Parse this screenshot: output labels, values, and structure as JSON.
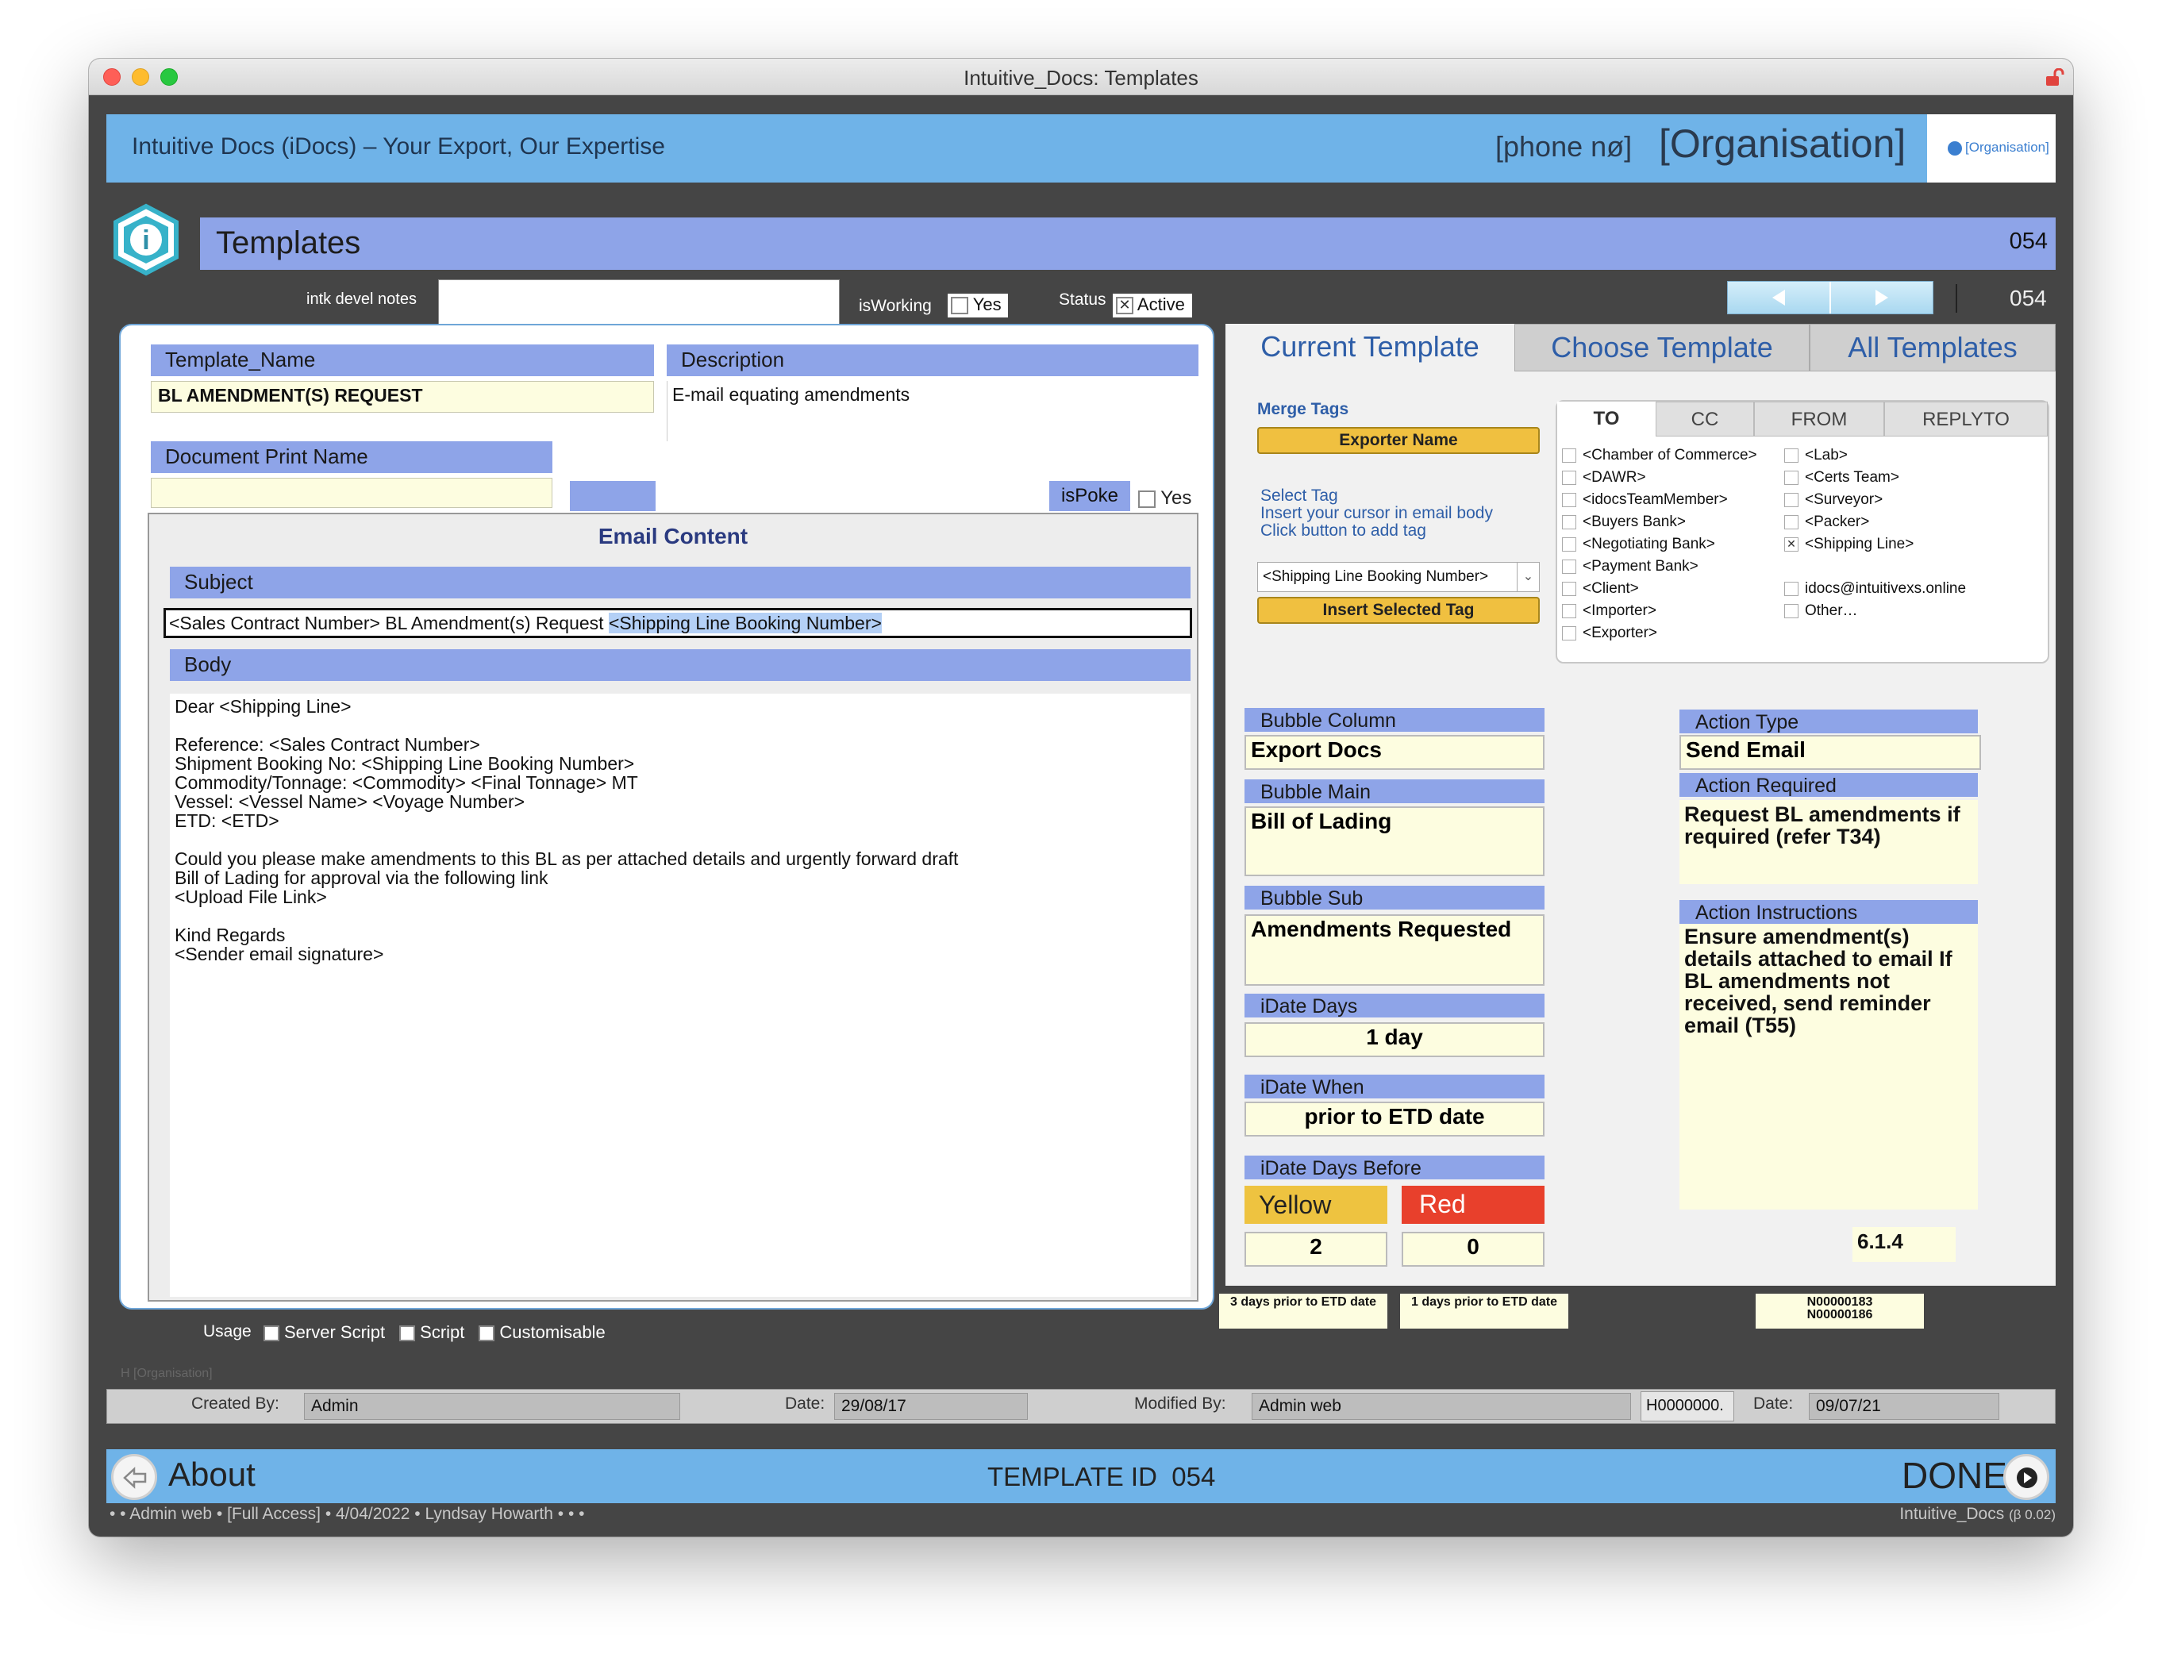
{
  "window": {
    "title": "Intuitive_Docs: Templates"
  },
  "banner": {
    "tagline": "Intuitive Docs (iDocs) – Your Export, Our Expertise",
    "phone": "[phone nø]",
    "organisation": "[Organisation]",
    "logo_text": "[Organisation]"
  },
  "page": {
    "title": "Templates",
    "record_id": "054",
    "nav_id": "054"
  },
  "top_controls": {
    "notes_label": "intk devel notes",
    "notes_value": "",
    "isworking_label": "isWorking",
    "isworking_option": "Yes",
    "status_label": "Status",
    "status_option": "Active"
  },
  "left": {
    "template_name_label": "Template_Name",
    "template_name_value": "BL AMENDMENT(S) REQUEST",
    "description_label": "Description",
    "description_value": "E-mail equating amendments",
    "print_name_label": "Document Print Name",
    "print_name_value": "",
    "ispoke_label": "isPoke",
    "ispoke_option": "Yes",
    "email_content_title": "Email Content",
    "subject_label": "Subject",
    "subject_plain": "<Sales Contract Number> BL Amendment(s) Request ",
    "subject_selected": "<Shipping Line Booking Number>",
    "body_label": "Body",
    "body_lines": [
      "Dear <Shipping Line>",
      "",
      "Reference: <Sales Contract Number>",
      "Shipment Booking No: <Shipping Line Booking Number>",
      "Commodity/Tonnage: <Commodity> <Final Tonnage> MT",
      "Vessel: <Vessel Name> <Voyage Number>",
      "ETD: <ETD>",
      "",
      "Could you please make amendments to this BL as per attached details and urgently forward draft",
      "Bill of Lading for approval via the following link",
      "<Upload File Link>",
      "",
      "Kind Regards",
      "<Sender email signature>"
    ]
  },
  "usage": {
    "label": "Usage",
    "options": [
      "Server Script",
      "Script",
      "Customisable"
    ]
  },
  "tabs": [
    "Current Template",
    "Choose Template",
    "All Templates"
  ],
  "merge": {
    "title": "Merge Tags",
    "exporter_button": "Exporter Name",
    "select_tag_lines": [
      "Select Tag",
      "Insert your cursor in email body",
      "Click button to add tag"
    ],
    "dropdown_value": "<Shipping Line Booking Number>",
    "insert_button": "Insert Selected Tag"
  },
  "recipient_tabs": [
    "TO",
    "CC",
    "FROM",
    "REPLYTO"
  ],
  "recipients_col1": [
    "<Chamber of Commerce>",
    "<DAWR>",
    "<idocsTeamMember>",
    "<Buyers Bank>",
    "<Negotiating Bank>",
    "<Payment Bank>",
    "<Client>",
    "<Importer>",
    "<Exporter>"
  ],
  "recipients_col2": [
    "<Lab>",
    "<Certs Team>",
    "<Surveyor>",
    "<Packer>",
    "<Shipping Line>",
    "",
    "idocs@intuitivexs.online",
    "Other…"
  ],
  "recipients_col2_checked": [
    false,
    false,
    false,
    false,
    true,
    false,
    false,
    false
  ],
  "bubble": {
    "column_label": "Bubble Column",
    "column_value": "Export Docs",
    "main_label": "Bubble Main",
    "main_value": "Bill of Lading",
    "sub_label": "Bubble Sub",
    "sub_value": "Amendments Requested",
    "idate_days_label": "iDate Days",
    "idate_days_value": "1 day",
    "idate_when_label": "iDate When",
    "idate_when_value": "prior to ETD date",
    "idate_before_label": "iDate Days Before",
    "yellow_label": "Yellow",
    "red_label": "Red",
    "yellow_value": "2",
    "red_value": "0",
    "yellow_note": "3 days prior to ETD date",
    "red_note": "1 days prior to ETD date"
  },
  "action": {
    "type_label": "Action Type",
    "type_value": "Send Email",
    "required_label": "Action Required",
    "required_value": "Request BL amendments if required (refer T34)",
    "instructions_label": "Action Instructions",
    "instructions_value": "Ensure amendment(s) details attached to email If BL amendments not received, send reminder email (T55)",
    "version": "6.1.4",
    "ids": [
      "N00000183",
      "N00000186"
    ]
  },
  "footer_strip": {
    "org_hint": "H   [Organisation]",
    "created_label": "Created By:",
    "created_value": "Admin",
    "date_label": "Date:",
    "date_value": "29/08/17",
    "modified_label": "Modified By:",
    "modified_value": "Admin web",
    "h_code": "H0000000.",
    "date2_label": "Date:",
    "date2_value": "09/07/21"
  },
  "bottom_bar": {
    "about_label": "About",
    "template_id_label": "TEMPLATE ID",
    "template_id_value": "054",
    "done_label": "DONE"
  },
  "status_line": {
    "left": "•  • Admin web • [Full Access] • 4/04/2022 • Lyndsay Howarth •  •  •",
    "right_app": "Intuitive_Docs",
    "right_version": "(β 0.02)"
  },
  "colors": {
    "window_bg": "#454545",
    "banner_blue": "#6fb3e8",
    "header_blue": "#8ea4e8",
    "field_yellow": "#fdfde0",
    "gold": "#f0c040",
    "red": "#e8402c"
  }
}
